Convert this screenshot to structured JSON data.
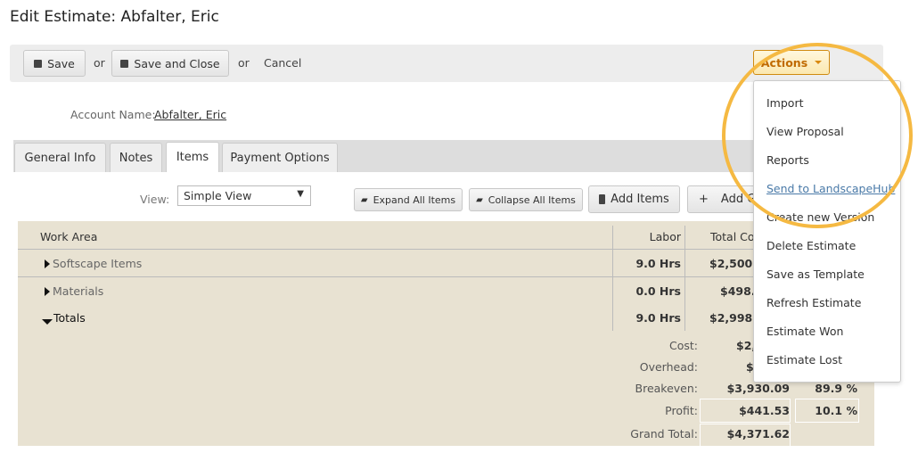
{
  "title": "Edit Estimate: Abfalter, Eric",
  "toolbar": {
    "save": "Save",
    "or1": "or",
    "save_close": "Save and Close",
    "or2": "or",
    "cancel": "Cancel",
    "actions": "Actions"
  },
  "account": {
    "label": "Account Name:",
    "value": "Abfalter, Eric"
  },
  "tabs": [
    {
      "label": "General Info"
    },
    {
      "label": "Notes"
    },
    {
      "label": "Items",
      "active": true
    },
    {
      "label": "Payment Options"
    }
  ],
  "view": {
    "label": "View:",
    "selected": "Simple View"
  },
  "item_buttons": {
    "expand": "Expand All Items",
    "collapse": "Collapse All Items",
    "add_items": "Add Items",
    "add_g": "Add G"
  },
  "table": {
    "headers": {
      "work_area": "Work Area",
      "labor": "Labor",
      "total": "Total Co"
    },
    "rows": [
      {
        "name": "Softscape Items",
        "labor": "9.0 Hrs",
        "total": "$2,500.3"
      },
      {
        "name": "Materials",
        "labor": "0.0 Hrs",
        "total": "$498.0"
      },
      {
        "name": "Totals",
        "labor": "9.0 Hrs",
        "total": "$2,998.3"
      }
    ],
    "summary": [
      {
        "label": "Cost:",
        "value": "$2,",
        "pct": ""
      },
      {
        "label": "Overhead:",
        "value": "$",
        "pct": ""
      },
      {
        "label": "Breakeven:",
        "value": "$3,930.09",
        "pct": "89.9 %"
      },
      {
        "label": "Profit:",
        "value": "$441.53",
        "pct": "10.1 %"
      },
      {
        "label": "Grand Total:",
        "value": "$4,371.62",
        "pct": ""
      }
    ]
  },
  "actions_menu": [
    "Import",
    "View Proposal",
    "Reports",
    "Send to LandscapeHub",
    "Create new Version",
    "Delete Estimate",
    "Save as Template",
    "Refresh Estimate",
    "Estimate Won",
    "Estimate Lost"
  ],
  "colors": {
    "accent": "#d08a10",
    "highlight_circle": "#f5b942",
    "grid_bg": "#e8e2d2"
  }
}
